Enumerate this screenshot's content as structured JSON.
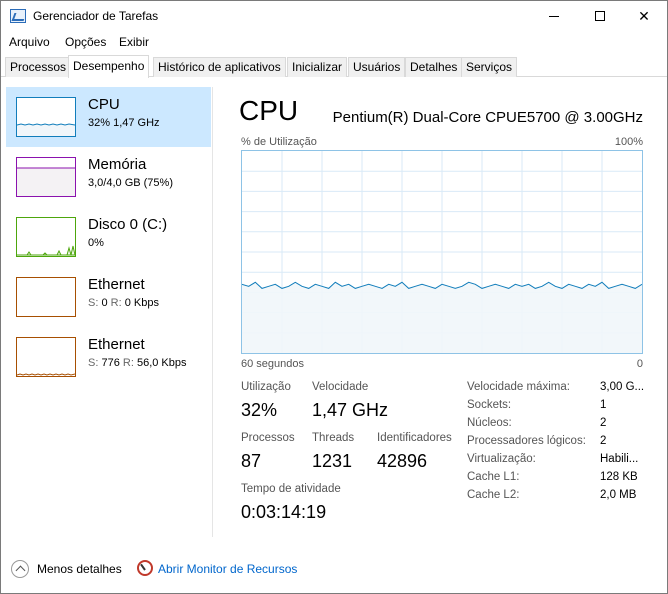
{
  "window": {
    "title": "Gerenciador de Tarefas",
    "icon": "task-manager-icon"
  },
  "menu": [
    "Arquivo",
    "Opções",
    "Exibir"
  ],
  "tabs": [
    {
      "label": "Processos",
      "active": false
    },
    {
      "label": "Desempenho",
      "active": true
    },
    {
      "label": "Histórico de aplicativos",
      "active": false
    },
    {
      "label": "Inicializar",
      "active": false
    },
    {
      "label": "Usuários",
      "active": false
    },
    {
      "label": "Detalhes",
      "active": false
    },
    {
      "label": "Serviços",
      "active": false
    }
  ],
  "sidebar": {
    "items": [
      {
        "title": "CPU",
        "subtitle": "32% 1,47 GHz",
        "selected": true,
        "color": "#117dbb"
      },
      {
        "title": "Memória",
        "subtitle": "3,0/4,0 GB (75%)",
        "selected": false,
        "color": "#8b12ae"
      },
      {
        "title": "Disco 0 (C:)",
        "subtitle": "0%",
        "selected": false,
        "color": "#4da60c"
      },
      {
        "title": "Ethernet",
        "sub_s_label": "S:",
        "sub_s": "0",
        "sub_r_label": "R:",
        "sub_r": "0 Kbps",
        "selected": false,
        "color": "#a74f01"
      },
      {
        "title": "Ethernet",
        "sub_s_label": "S:",
        "sub_s": "776",
        "sub_r_label": "R:",
        "sub_r": "56,0 Kbps",
        "selected": false,
        "color": "#a74f01"
      }
    ]
  },
  "main": {
    "title": "CPU",
    "model": "Pentium(R) Dual-Core CPUE5700 @ 3.00GHz",
    "graph_label_left": "% de Utilização",
    "graph_label_right": "100%",
    "graph_time_left": "60 segundos",
    "graph_time_right": "0",
    "graph_color": "#117dbb",
    "utilization_history": [
      34,
      33,
      35,
      32,
      33,
      34,
      32,
      33,
      35,
      33,
      32,
      34,
      33,
      32,
      35,
      33,
      34,
      32,
      33,
      34,
      33,
      32,
      34,
      33,
      35,
      32,
      33,
      34,
      33,
      32,
      34,
      33,
      32,
      33,
      35,
      34,
      32,
      33,
      34,
      33,
      32,
      34,
      33,
      34,
      32,
      33,
      35,
      33,
      32,
      34,
      33,
      32,
      34,
      33,
      35,
      32,
      33,
      34,
      33,
      32,
      34
    ],
    "stats": {
      "util_label": "Utilização",
      "util_value": "32%",
      "speed_label": "Velocidade",
      "speed_value": "1,47 GHz",
      "proc_label": "Processos",
      "proc_value": "87",
      "threads_label": "Threads",
      "threads_value": "1231",
      "handles_label": "Identificadores",
      "handles_value": "42896",
      "uptime_label": "Tempo de atividade",
      "uptime_value": "0:03:14:19"
    },
    "specs": [
      {
        "label": "Velocidade máxima:",
        "value": "3,00 G..."
      },
      {
        "label": "Sockets:",
        "value": "1"
      },
      {
        "label": "Núcleos:",
        "value": "2"
      },
      {
        "label": "Processadores lógicos:",
        "value": "2"
      },
      {
        "label": "Virtualização:",
        "value": "Habili..."
      },
      {
        "label": "Cache L1:",
        "value": "128 KB"
      },
      {
        "label": "Cache L2:",
        "value": "2,0 MB"
      }
    ]
  },
  "footer": {
    "less_details": "Menos detalhes",
    "resource_monitor": "Abrir Monitor de Recursos"
  }
}
